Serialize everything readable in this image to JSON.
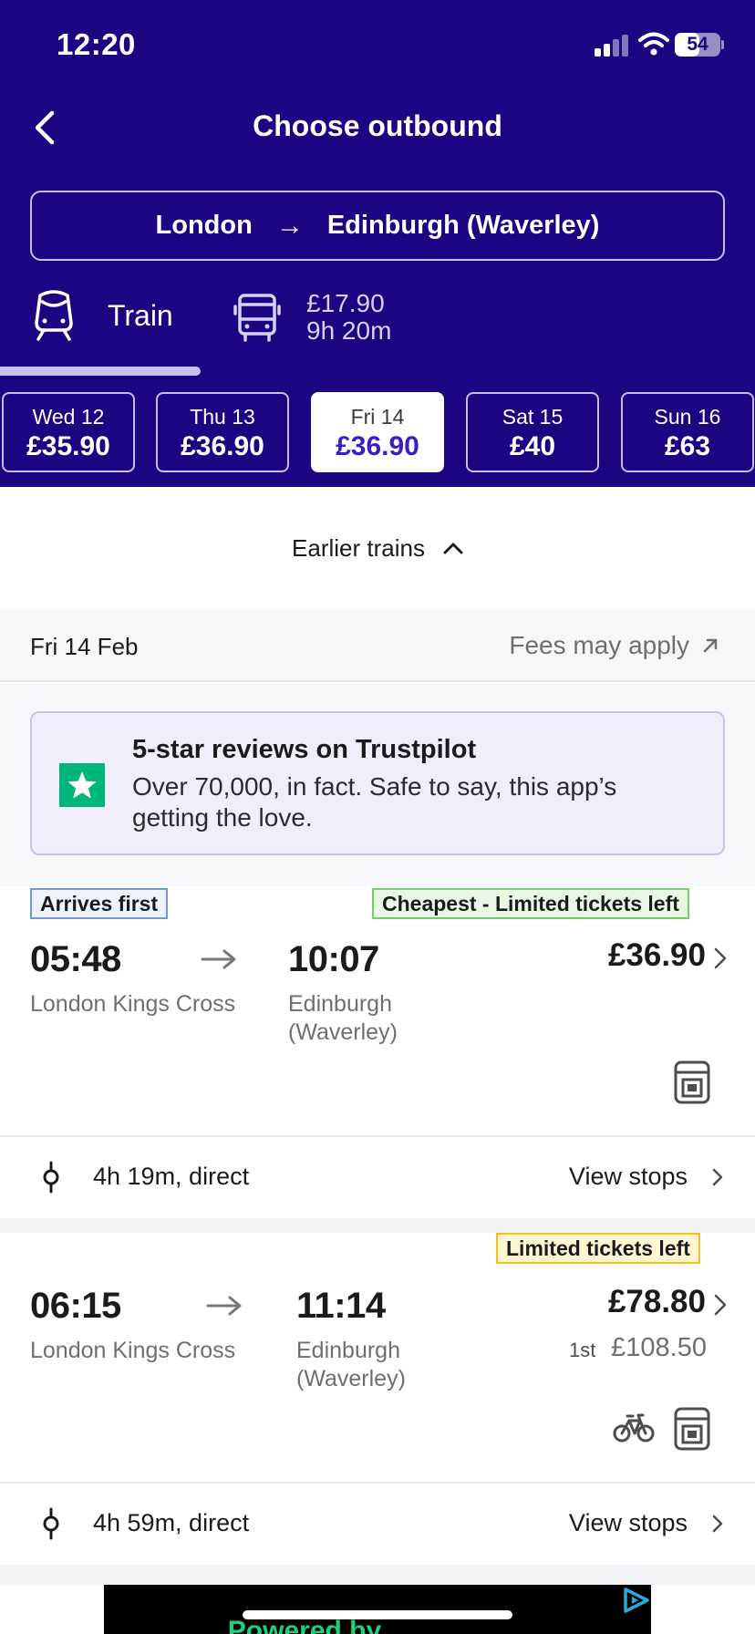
{
  "status_bar": {
    "time": "12:20",
    "battery": "54",
    "battery_level": 0.54
  },
  "nav": {
    "title": "Choose outbound"
  },
  "route": {
    "origin": "London",
    "arrow": "→",
    "destination": "Edinburgh (Waverley)"
  },
  "modes": {
    "train": {
      "label": "Train",
      "icon": "train-icon",
      "selected": true
    },
    "bus": {
      "price": "£17.90",
      "duration": "9h 20m",
      "icon": "bus-icon"
    }
  },
  "dates": [
    {
      "day": "Wed 12",
      "price": "£35.90",
      "selected": false
    },
    {
      "day": "Thu 13",
      "price": "£36.90",
      "selected": false
    },
    {
      "day": "Fri 14",
      "price": "£36.90",
      "selected": true
    },
    {
      "day": "Sat 15",
      "price": "£40",
      "selected": false
    },
    {
      "day": "Sun 16",
      "price": "£63",
      "selected": false
    }
  ],
  "earlier": {
    "label": "Earlier trains"
  },
  "date_bar": {
    "date": "Fri 14 Feb",
    "fees": "Fees may apply"
  },
  "promo": {
    "title": "5-star reviews on Trustpilot",
    "body": "Over 70,000, in fact. Safe to say, this app’s getting the love."
  },
  "journeys": [
    {
      "tags": [
        "Arrives first",
        "Cheapest - Limited tickets left"
      ],
      "depart_time": "05:48",
      "depart_station": "London Kings Cross",
      "arrive_time": "10:07",
      "arrive_station": "Edinburgh (Waverley)",
      "price": "£36.90",
      "summary": "4h 19m, direct",
      "view_stops": "View stops",
      "amenities": [
        "seat-reservation-icon"
      ]
    },
    {
      "tags": [
        "Limited tickets left"
      ],
      "depart_time": "06:15",
      "depart_station": "London Kings Cross",
      "arrive_time": "11:14",
      "arrive_station": "Edinburgh (Waverley)",
      "price": "£78.80",
      "first_class_label": "1st",
      "first_class_price": "£108.50",
      "summary": "4h 59m, direct",
      "view_stops": "View stops",
      "amenities": [
        "bicycle-icon",
        "seat-reservation-icon"
      ]
    }
  ],
  "ad": {
    "text": "Powered by"
  },
  "colors": {
    "header_bg": "#1d0482",
    "accent": "#3c1cc6",
    "trustpilot_green": "#00b67a"
  }
}
